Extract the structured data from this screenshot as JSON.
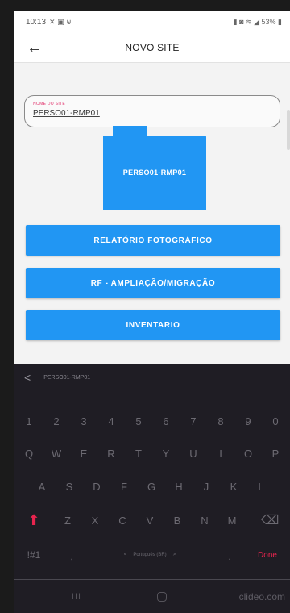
{
  "status_bar": {
    "time": "10:13",
    "left_icons": "✕ ▣ ⊎",
    "right_icons": "▮ ◙ ≋ ◢ 53% ▮"
  },
  "app_bar": {
    "back_glyph": "←",
    "title": "NOVO SITE"
  },
  "form": {
    "name_label": "NOME DO SITE",
    "name_value": "PERSO01-RMP01"
  },
  "folder": {
    "label": "PERSO01-RMP01",
    "color": "#2196f3"
  },
  "buttons": [
    {
      "label": "RELATÓRIO FOTOGRÁFICO"
    },
    {
      "label": "RF - AMPLIAÇÃO/MIGRAÇÃO"
    },
    {
      "label": "INVENTARIO"
    }
  ],
  "keyboard": {
    "suggestion_chevron": "<",
    "suggestion_text": "PERSO01-RMP01",
    "number_row": [
      "1",
      "2",
      "3",
      "4",
      "5",
      "6",
      "7",
      "8",
      "9",
      "0"
    ],
    "row_1": [
      "Q",
      "W",
      "E",
      "R",
      "T",
      "Y",
      "U",
      "I",
      "O",
      "P"
    ],
    "row_2": [
      "A",
      "S",
      "D",
      "F",
      "G",
      "H",
      "J",
      "K",
      "L"
    ],
    "row_3": [
      "Z",
      "X",
      "C",
      "V",
      "B",
      "N",
      "M"
    ],
    "shift_glyph": "⬆",
    "backspace_glyph": "⌫",
    "sym_label": "!#1",
    "comma": ",",
    "space_left": "<",
    "space_label": "Português (BR)",
    "space_right": ">",
    "period": ".",
    "done_label": "Done",
    "accent_color": "#e8244e"
  },
  "nav_bar": {
    "recent_glyph": "III",
    "watermark": "clideo.com"
  }
}
